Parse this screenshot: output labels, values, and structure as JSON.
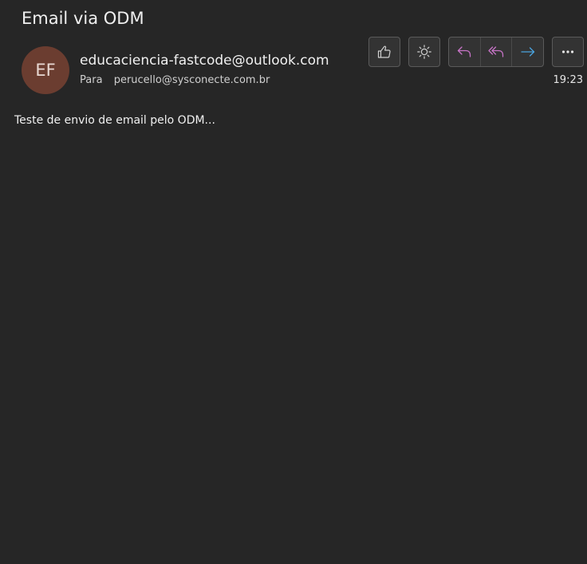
{
  "message": {
    "subject": "Email via ODM",
    "sender": {
      "initials": "EF",
      "address": "educaciencia-fastcode@outlook.com",
      "avatar_color": "#6b3d30"
    },
    "to_label": "Para",
    "to_address": "perucello@sysconecte.com.br",
    "time": "19:23",
    "body": "Teste de envio de email pelo ODM..."
  },
  "toolbar": {
    "like_icon": "thumbs-up-icon",
    "theme_icon": "sun-icon",
    "reply_icon": "reply-icon",
    "reply_all_icon": "reply-all-icon",
    "forward_icon": "forward-icon",
    "more_icon": "more-icon",
    "reply_color": "#c774c7",
    "forward_color": "#4aa3df"
  },
  "theme": {
    "background": "#262626",
    "button_background": "#333333",
    "button_border": "#5a5a5a"
  }
}
